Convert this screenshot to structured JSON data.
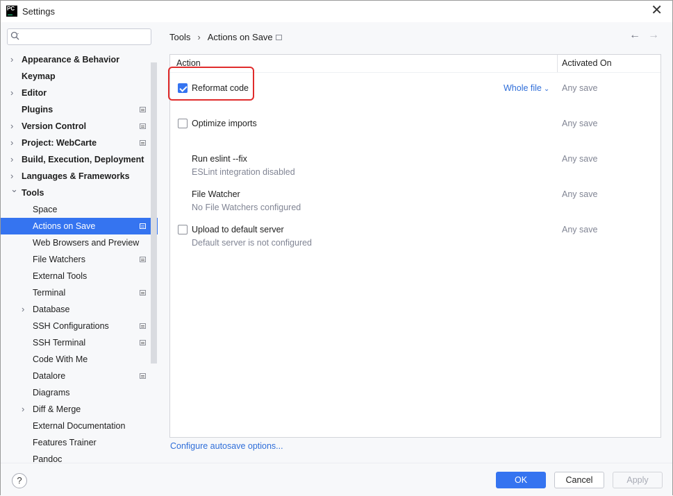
{
  "window": {
    "title": "Settings",
    "close_icon": "close-icon"
  },
  "search": {
    "placeholder": "",
    "value": ""
  },
  "tree": [
    {
      "label": "Appearance & Behavior",
      "level": 0,
      "expandable": true,
      "expanded": false,
      "project_icon": false
    },
    {
      "label": "Keymap",
      "level": 0,
      "expandable": false,
      "project_icon": false
    },
    {
      "label": "Editor",
      "level": 0,
      "expandable": true,
      "expanded": false,
      "project_icon": false
    },
    {
      "label": "Plugins",
      "level": 0,
      "expandable": false,
      "project_icon": true
    },
    {
      "label": "Version Control",
      "level": 0,
      "expandable": true,
      "expanded": false,
      "project_icon": true
    },
    {
      "label": "Project: WebCarte",
      "level": 0,
      "expandable": true,
      "expanded": false,
      "project_icon": true
    },
    {
      "label": "Build, Execution, Deployment",
      "level": 0,
      "expandable": true,
      "expanded": false,
      "project_icon": false
    },
    {
      "label": "Languages & Frameworks",
      "level": 0,
      "expandable": true,
      "expanded": false,
      "project_icon": false
    },
    {
      "label": "Tools",
      "level": 0,
      "expandable": true,
      "expanded": true,
      "project_icon": false
    },
    {
      "label": "Space",
      "level": 1,
      "expandable": false,
      "project_icon": false
    },
    {
      "label": "Actions on Save",
      "level": 1,
      "expandable": false,
      "project_icon": true,
      "selected": true
    },
    {
      "label": "Web Browsers and Preview",
      "level": 1,
      "expandable": false,
      "project_icon": false
    },
    {
      "label": "File Watchers",
      "level": 1,
      "expandable": false,
      "project_icon": true
    },
    {
      "label": "External Tools",
      "level": 1,
      "expandable": false,
      "project_icon": false
    },
    {
      "label": "Terminal",
      "level": 1,
      "expandable": false,
      "project_icon": true
    },
    {
      "label": "Database",
      "level": 1,
      "expandable": true,
      "expanded": false,
      "project_icon": false
    },
    {
      "label": "SSH Configurations",
      "level": 1,
      "expandable": false,
      "project_icon": true
    },
    {
      "label": "SSH Terminal",
      "level": 1,
      "expandable": false,
      "project_icon": true
    },
    {
      "label": "Code With Me",
      "level": 1,
      "expandable": false,
      "project_icon": false
    },
    {
      "label": "Datalore",
      "level": 1,
      "expandable": false,
      "project_icon": true
    },
    {
      "label": "Diagrams",
      "level": 1,
      "expandable": false,
      "project_icon": false
    },
    {
      "label": "Diff & Merge",
      "level": 1,
      "expandable": true,
      "expanded": false,
      "project_icon": false
    },
    {
      "label": "External Documentation",
      "level": 1,
      "expandable": false,
      "project_icon": false
    },
    {
      "label": "Features Trainer",
      "level": 1,
      "expandable": false,
      "project_icon": false
    },
    {
      "label": "Pandoc",
      "level": 1,
      "expandable": false,
      "project_icon": false
    }
  ],
  "breadcrumb": {
    "parent": "Tools",
    "current": "Actions on Save",
    "separator": "›"
  },
  "nav": {
    "back_icon": "arrow-left-icon",
    "forward_icon": "arrow-right-icon"
  },
  "table": {
    "headers": {
      "action": "Action",
      "activated_on": "Activated On"
    },
    "rows": [
      {
        "name": "Reformat code",
        "has_checkbox": true,
        "checked": true,
        "subtitle": "",
        "scope": "Whole file",
        "activated_on": "Any save",
        "highlighted": true
      },
      {
        "name": "Optimize imports",
        "has_checkbox": true,
        "checked": false,
        "subtitle": "",
        "scope": "",
        "activated_on": "Any save"
      },
      {
        "name": "Run eslint --fix",
        "has_checkbox": false,
        "checked": false,
        "subtitle": "ESLint integration disabled",
        "scope": "",
        "activated_on": "Any save"
      },
      {
        "name": "File Watcher",
        "has_checkbox": false,
        "checked": false,
        "subtitle": "No File Watchers configured",
        "scope": "",
        "activated_on": "Any save"
      },
      {
        "name": "Upload to default server",
        "has_checkbox": true,
        "checked": false,
        "subtitle": "Default server is not configured",
        "scope": "",
        "activated_on": "Any save"
      }
    ]
  },
  "link": {
    "autosave": "Configure autosave options..."
  },
  "buttons": {
    "help": "?",
    "ok": "OK",
    "cancel": "Cancel",
    "apply": "Apply"
  },
  "colors": {
    "accent": "#3574f0",
    "link": "#2f6ed9",
    "highlight_box": "#e02b2b",
    "muted_text": "#818594"
  }
}
